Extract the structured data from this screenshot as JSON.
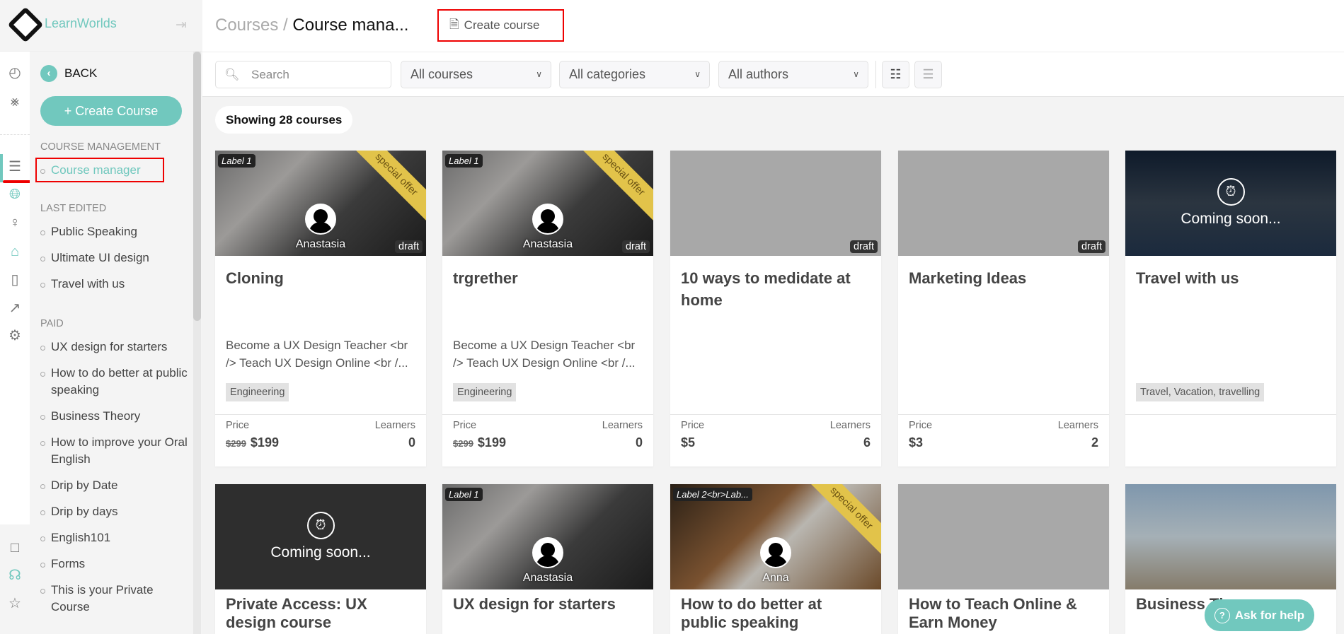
{
  "brand": {
    "name": "LearnWorlds",
    "accent": "#71c8be"
  },
  "sidebar": {
    "back": "BACK",
    "create_course": "Create Course",
    "course_management": {
      "heading": "COURSE MANAGEMENT",
      "items": [
        {
          "label": "Course manager",
          "active": true
        }
      ]
    },
    "last_edited": {
      "heading": "LAST EDITED",
      "items": [
        {
          "label": "Public Speaking"
        },
        {
          "label": "Ultimate UI design"
        },
        {
          "label": "Travel with us"
        }
      ]
    },
    "paid": {
      "heading": "PAID",
      "items": [
        {
          "label": "UX design for starters"
        },
        {
          "label": "How to do better at public speaking"
        },
        {
          "label": "Business Theory"
        },
        {
          "label": "How to improve your Oral English"
        },
        {
          "label": "Drip by Date"
        },
        {
          "label": "Drip by days"
        },
        {
          "label": "English101"
        },
        {
          "label": "Forms"
        },
        {
          "label": "This is your Private Course"
        }
      ]
    },
    "rail_icons": [
      "dashboard-icon",
      "wifi-icon",
      "courses-icon",
      "globe-icon",
      "user-icon",
      "tag-icon",
      "mobile-icon",
      "analytics-icon",
      "settings-icon",
      "clipboard-icon",
      "headset-icon",
      "user-star-icon"
    ]
  },
  "header": {
    "breadcrumb_root": "Courses",
    "breadcrumb_sep": "/",
    "breadcrumb_current": "Course mana...",
    "create_course": "Create course"
  },
  "toolbar": {
    "search_placeholder": "Search",
    "filter_courses": "All courses",
    "filter_categories": "All categories",
    "filter_authors": "All authors"
  },
  "count_text": "Showing 28 courses",
  "courses": [
    {
      "image": "laptop",
      "label": "Label 1",
      "ribbon": "special offer",
      "author": "Anastasia",
      "status": "draft",
      "title": "Cloning",
      "description": "Become a UX Design Teacher <br /> Teach UX Design Online <br /...",
      "tag": "Engineering",
      "price_label": "Price",
      "old_price": "$299",
      "price": "$199",
      "learners_label": "Learners",
      "learners": "0"
    },
    {
      "image": "laptop",
      "label": "Label 1",
      "ribbon": "special offer",
      "author": "Anastasia",
      "status": "draft",
      "title": "trgrether",
      "description": "Become a UX Design Teacher <br /> Teach UX Design Online <br /...",
      "tag": "Engineering",
      "price_label": "Price",
      "old_price": "$299",
      "price": "$199",
      "learners_label": "Learners",
      "learners": "0"
    },
    {
      "image": "gray",
      "status": "draft",
      "title": "10 ways to medidate at home",
      "price_label": "Price",
      "price": "$5",
      "learners_label": "Learners",
      "learners": "6"
    },
    {
      "image": "gray",
      "status": "draft",
      "title": "Marketing Ideas",
      "price_label": "Price",
      "price": "$3",
      "learners_label": "Learners",
      "learners": "2"
    },
    {
      "image": "travel",
      "coming_soon": "Coming soon...",
      "title": "Travel with us",
      "tag": "Travel, Vacation, travelling"
    },
    {
      "image": "dark",
      "coming_soon": "Coming soon...",
      "title": "Private Access: UX design course"
    },
    {
      "image": "laptop",
      "label": "Label 1",
      "author": "Anastasia",
      "title": "UX design for starters"
    },
    {
      "image": "desk",
      "label": "Label 2<br>Lab...",
      "ribbon": "special offer",
      "author": "Anna",
      "title": "How to do better at public speaking"
    },
    {
      "image": "gray",
      "title": "How to Teach Online & Earn Money"
    },
    {
      "image": "globe",
      "title": "Business Theory"
    }
  ],
  "help": "Ask for help"
}
